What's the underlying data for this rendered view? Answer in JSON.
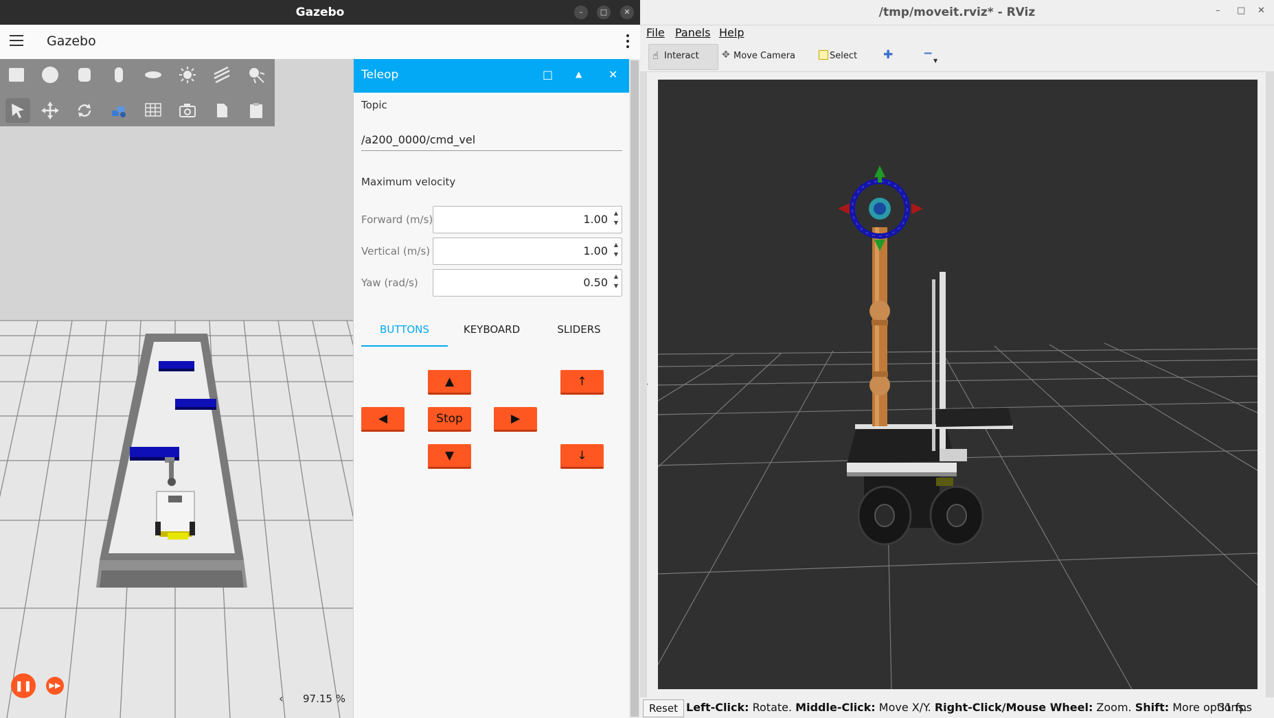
{
  "gazebo": {
    "window_title": "Gazebo",
    "app_title": "Gazebo",
    "zoom": "97.15 %",
    "teleop": {
      "title": "Teleop",
      "topic_label": "Topic",
      "topic_value": "/a200_0000/cmd_vel",
      "max_velocity_label": "Maximum velocity",
      "fields": [
        {
          "label": "Forward (m/s)",
          "value": "1.00"
        },
        {
          "label": "Vertical (m/s)",
          "value": "1.00"
        },
        {
          "label": "Yaw (rad/s)",
          "value": "0.50"
        }
      ],
      "tabs": [
        "BUTTONS",
        "KEYBOARD",
        "SLIDERS"
      ],
      "active_tab": "BUTTONS",
      "buttons": {
        "forward": "▲",
        "left": "◀",
        "stop": "Stop",
        "right": "▶",
        "backward": "▼",
        "up": "↑",
        "down": "↓"
      }
    }
  },
  "rviz": {
    "window_title": "/tmp/moveit.rviz* - RViz",
    "menu": [
      "File",
      "Panels",
      "Help"
    ],
    "toolbar": {
      "interact": "Interact",
      "move_camera": "Move Camera",
      "select": "Select"
    },
    "status": {
      "reset": "Reset",
      "hint_parts": [
        {
          "b": "Left-Click:",
          "t": " Rotate. "
        },
        {
          "b": "Middle-Click:",
          "t": " Move X/Y. "
        },
        {
          "b": "Right-Click/Mouse Wheel:",
          "t": " Zoom. "
        },
        {
          "b": "Shift:",
          "t": " More options."
        }
      ],
      "fps": "31 fps"
    }
  },
  "colors": {
    "accent_blue": "#03a9f4",
    "orange": "#ff5722",
    "rviz_background": "#303030"
  }
}
